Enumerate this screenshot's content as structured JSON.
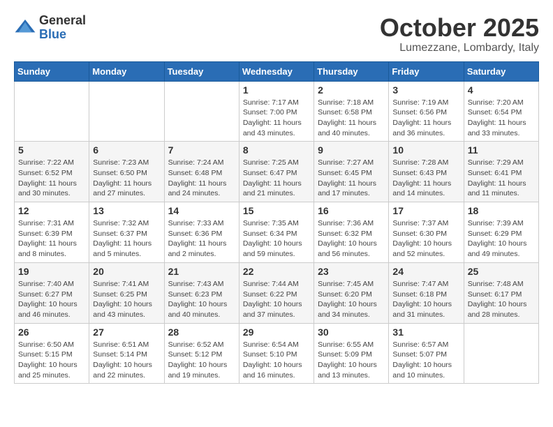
{
  "header": {
    "logo_general": "General",
    "logo_blue": "Blue",
    "month_title": "October 2025",
    "location": "Lumezzane, Lombardy, Italy"
  },
  "days_of_week": [
    "Sunday",
    "Monday",
    "Tuesday",
    "Wednesday",
    "Thursday",
    "Friday",
    "Saturday"
  ],
  "weeks": [
    {
      "shaded": false,
      "days": [
        {
          "num": "",
          "info": ""
        },
        {
          "num": "",
          "info": ""
        },
        {
          "num": "",
          "info": ""
        },
        {
          "num": "1",
          "info": "Sunrise: 7:17 AM\nSunset: 7:00 PM\nDaylight: 11 hours and 43 minutes."
        },
        {
          "num": "2",
          "info": "Sunrise: 7:18 AM\nSunset: 6:58 PM\nDaylight: 11 hours and 40 minutes."
        },
        {
          "num": "3",
          "info": "Sunrise: 7:19 AM\nSunset: 6:56 PM\nDaylight: 11 hours and 36 minutes."
        },
        {
          "num": "4",
          "info": "Sunrise: 7:20 AM\nSunset: 6:54 PM\nDaylight: 11 hours and 33 minutes."
        }
      ]
    },
    {
      "shaded": true,
      "days": [
        {
          "num": "5",
          "info": "Sunrise: 7:22 AM\nSunset: 6:52 PM\nDaylight: 11 hours and 30 minutes."
        },
        {
          "num": "6",
          "info": "Sunrise: 7:23 AM\nSunset: 6:50 PM\nDaylight: 11 hours and 27 minutes."
        },
        {
          "num": "7",
          "info": "Sunrise: 7:24 AM\nSunset: 6:48 PM\nDaylight: 11 hours and 24 minutes."
        },
        {
          "num": "8",
          "info": "Sunrise: 7:25 AM\nSunset: 6:47 PM\nDaylight: 11 hours and 21 minutes."
        },
        {
          "num": "9",
          "info": "Sunrise: 7:27 AM\nSunset: 6:45 PM\nDaylight: 11 hours and 17 minutes."
        },
        {
          "num": "10",
          "info": "Sunrise: 7:28 AM\nSunset: 6:43 PM\nDaylight: 11 hours and 14 minutes."
        },
        {
          "num": "11",
          "info": "Sunrise: 7:29 AM\nSunset: 6:41 PM\nDaylight: 11 hours and 11 minutes."
        }
      ]
    },
    {
      "shaded": false,
      "days": [
        {
          "num": "12",
          "info": "Sunrise: 7:31 AM\nSunset: 6:39 PM\nDaylight: 11 hours and 8 minutes."
        },
        {
          "num": "13",
          "info": "Sunrise: 7:32 AM\nSunset: 6:37 PM\nDaylight: 11 hours and 5 minutes."
        },
        {
          "num": "14",
          "info": "Sunrise: 7:33 AM\nSunset: 6:36 PM\nDaylight: 11 hours and 2 minutes."
        },
        {
          "num": "15",
          "info": "Sunrise: 7:35 AM\nSunset: 6:34 PM\nDaylight: 10 hours and 59 minutes."
        },
        {
          "num": "16",
          "info": "Sunrise: 7:36 AM\nSunset: 6:32 PM\nDaylight: 10 hours and 56 minutes."
        },
        {
          "num": "17",
          "info": "Sunrise: 7:37 AM\nSunset: 6:30 PM\nDaylight: 10 hours and 52 minutes."
        },
        {
          "num": "18",
          "info": "Sunrise: 7:39 AM\nSunset: 6:29 PM\nDaylight: 10 hours and 49 minutes."
        }
      ]
    },
    {
      "shaded": true,
      "days": [
        {
          "num": "19",
          "info": "Sunrise: 7:40 AM\nSunset: 6:27 PM\nDaylight: 10 hours and 46 minutes."
        },
        {
          "num": "20",
          "info": "Sunrise: 7:41 AM\nSunset: 6:25 PM\nDaylight: 10 hours and 43 minutes."
        },
        {
          "num": "21",
          "info": "Sunrise: 7:43 AM\nSunset: 6:23 PM\nDaylight: 10 hours and 40 minutes."
        },
        {
          "num": "22",
          "info": "Sunrise: 7:44 AM\nSunset: 6:22 PM\nDaylight: 10 hours and 37 minutes."
        },
        {
          "num": "23",
          "info": "Sunrise: 7:45 AM\nSunset: 6:20 PM\nDaylight: 10 hours and 34 minutes."
        },
        {
          "num": "24",
          "info": "Sunrise: 7:47 AM\nSunset: 6:18 PM\nDaylight: 10 hours and 31 minutes."
        },
        {
          "num": "25",
          "info": "Sunrise: 7:48 AM\nSunset: 6:17 PM\nDaylight: 10 hours and 28 minutes."
        }
      ]
    },
    {
      "shaded": false,
      "days": [
        {
          "num": "26",
          "info": "Sunrise: 6:50 AM\nSunset: 5:15 PM\nDaylight: 10 hours and 25 minutes."
        },
        {
          "num": "27",
          "info": "Sunrise: 6:51 AM\nSunset: 5:14 PM\nDaylight: 10 hours and 22 minutes."
        },
        {
          "num": "28",
          "info": "Sunrise: 6:52 AM\nSunset: 5:12 PM\nDaylight: 10 hours and 19 minutes."
        },
        {
          "num": "29",
          "info": "Sunrise: 6:54 AM\nSunset: 5:10 PM\nDaylight: 10 hours and 16 minutes."
        },
        {
          "num": "30",
          "info": "Sunrise: 6:55 AM\nSunset: 5:09 PM\nDaylight: 10 hours and 13 minutes."
        },
        {
          "num": "31",
          "info": "Sunrise: 6:57 AM\nSunset: 5:07 PM\nDaylight: 10 hours and 10 minutes."
        },
        {
          "num": "",
          "info": ""
        }
      ]
    }
  ]
}
